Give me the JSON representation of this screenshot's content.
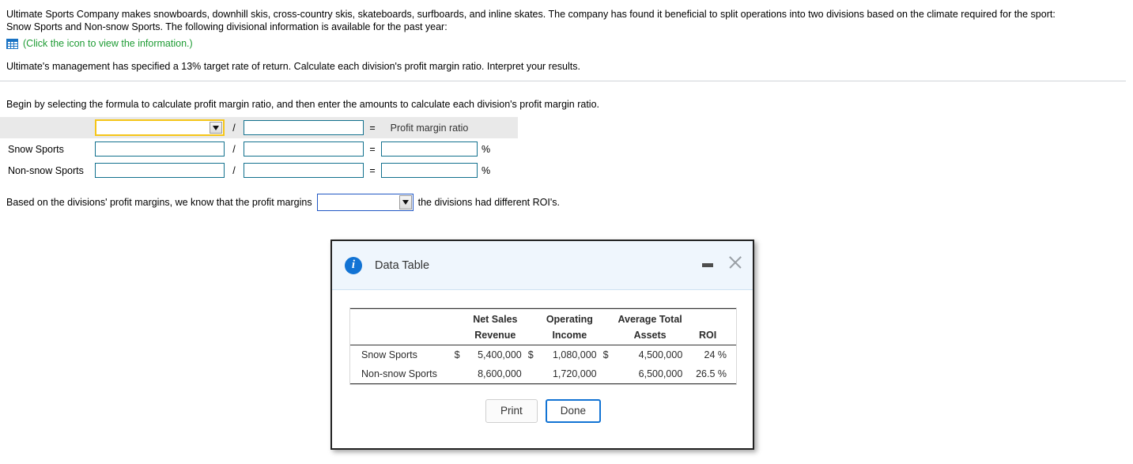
{
  "intro": {
    "paragraph_line1": "Ultimate Sports Company makes snowboards, downhill skis, cross-country skis, skateboards, surfboards, and inline skates. The company has found it beneficial to split operations into two divisions based on the climate required for the sport:",
    "paragraph_line2": "Snow Sports and Non-snow Sports. The following divisional information is available for the past year:",
    "icon_name": "data-table-grid-icon",
    "icon_note": "(Click the icon to view the information.)",
    "icon_note_color": "#1f9c35",
    "question": "Ultimate's management has specified a 13% target rate of return. Calculate each division's profit margin ratio. Interpret your results."
  },
  "instruction": "Begin by selecting the formula to calculate profit margin ratio, and then enter the amounts to calculate each division's profit margin ratio.",
  "formula": {
    "header": {
      "label": "",
      "dropdown_value": "",
      "dropdown_icon": "chevron-down-icon",
      "dropdown_border_color": "#f5c518",
      "slash": "/",
      "denominator_value": "",
      "equals": "=",
      "result_label": "Profit margin ratio"
    },
    "rows": [
      {
        "label": "Snow Sports",
        "numerator_value": "",
        "slash": "/",
        "denominator_value": "",
        "equals": "=",
        "result_value": "",
        "unit": "%"
      },
      {
        "label": "Non-snow Sports",
        "numerator_value": "",
        "slash": "/",
        "denominator_value": "",
        "equals": "=",
        "result_value": "",
        "unit": "%"
      }
    ]
  },
  "conclusion": {
    "text_before": "Based on the divisions' profit margins, we know that the profit margins",
    "dropdown_value": "",
    "dropdown_icon": "chevron-down-icon",
    "text_after": "the divisions had different ROI's."
  },
  "modal": {
    "title": "Data Table",
    "info_icon": "info-circle-icon",
    "info_icon_color": "#1273d4",
    "minimize_icon": "minimize-icon",
    "close_icon": "close-icon",
    "table": {
      "header_row1": [
        "",
        "",
        "Net Sales",
        "",
        "Operating",
        "",
        "Average Total",
        ""
      ],
      "header_row2": [
        "",
        "",
        "Revenue",
        "",
        "Income",
        "",
        "Assets",
        "ROI"
      ],
      "rows": [
        {
          "name": "Snow Sports",
          "net_sales_currency": "$",
          "net_sales_revenue": "5,400,000",
          "operating_currency": "$",
          "operating_income": "1,080,000",
          "assets_currency": "$",
          "average_total_assets": "4,500,000",
          "roi": "24 %"
        },
        {
          "name": "Non-snow Sports",
          "net_sales_currency": "",
          "net_sales_revenue": "8,600,000",
          "operating_currency": "",
          "operating_income": "1,720,000",
          "assets_currency": "",
          "average_total_assets": "6,500,000",
          "roi": "26.5 %"
        }
      ]
    },
    "buttons": {
      "print": "Print",
      "done": "Done"
    }
  }
}
